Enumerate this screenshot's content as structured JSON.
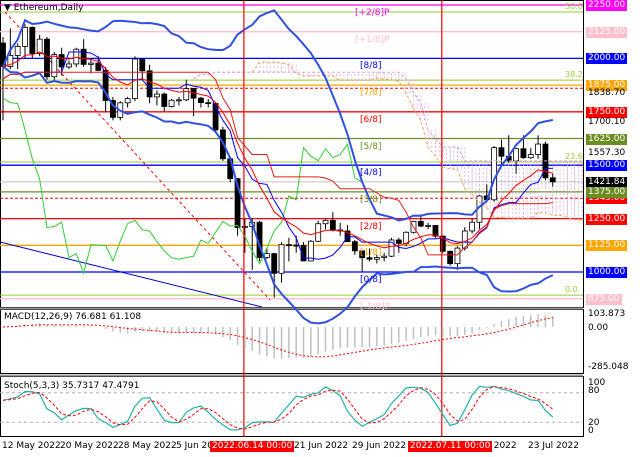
{
  "window": {
    "title": "Ethereum,Daily",
    "menu_icon": "triangle-down-icon"
  },
  "chart_data": [
    {
      "type": "candlestick",
      "title": "Ethereum,Daily",
      "ylim": [
        860.1,
        2250
      ],
      "x_ticks": [
        "12 May 2022",
        "20 May 2022",
        "28 May 2022",
        "5 Jun 2022",
        "21 Jun 2022",
        "29 Jun 2022",
        "Jul 2022",
        "23 Jul 2022"
      ],
      "markers": [
        {
          "label": "2022.06.14 00:00",
          "day_index": 33
        },
        {
          "label": "2022.07.11 00:00",
          "day_index": 60
        }
      ],
      "candles_ohlc": [
        [
          2072,
          2100,
          1710,
          1962
        ],
        [
          1962,
          2140,
          1950,
          2014
        ],
        [
          2014,
          2070,
          1950,
          2056
        ],
        [
          2056,
          2160,
          2000,
          2145
        ],
        [
          2145,
          2150,
          2000,
          2023
        ],
        [
          2023,
          2110,
          2010,
          2090
        ],
        [
          2090,
          2100,
          1900,
          1914
        ],
        [
          1914,
          2030,
          1900,
          2018
        ],
        [
          2018,
          2050,
          1920,
          1960
        ],
        [
          1960,
          1990,
          1950,
          1974
        ],
        [
          1974,
          2050,
          1960,
          2043
        ],
        [
          2043,
          2090,
          1960,
          1972
        ],
        [
          1972,
          2000,
          1930,
          1978
        ],
        [
          1978,
          2010,
          1940,
          1944
        ],
        [
          1944,
          1960,
          1750,
          1803
        ],
        [
          1803,
          1820,
          1710,
          1724
        ],
        [
          1724,
          1800,
          1710,
          1792
        ],
        [
          1792,
          1820,
          1770,
          1812
        ],
        [
          1812,
          2010,
          1800,
          1997
        ],
        [
          1997,
          2000,
          1900,
          1942
        ],
        [
          1942,
          1970,
          1790,
          1820
        ],
        [
          1820,
          1850,
          1780,
          1833
        ],
        [
          1833,
          1840,
          1750,
          1775
        ],
        [
          1775,
          1810,
          1770,
          1804
        ],
        [
          1804,
          1820,
          1780,
          1806
        ],
        [
          1806,
          1900,
          1800,
          1859
        ],
        [
          1859,
          1860,
          1730,
          1814
        ],
        [
          1814,
          1820,
          1770,
          1793
        ],
        [
          1793,
          1810,
          1770,
          1789
        ],
        [
          1789,
          1790,
          1650,
          1665
        ],
        [
          1665,
          1680,
          1520,
          1530
        ],
        [
          1530,
          1540,
          1420,
          1437
        ],
        [
          1437,
          1440,
          1170,
          1208
        ],
        [
          1208,
          1250,
          1090,
          1213
        ],
        [
          1213,
          1250,
          1010,
          1233
        ],
        [
          1233,
          1240,
          1050,
          1068
        ],
        [
          1068,
          1110,
          1060,
          1086
        ],
        [
          1086,
          1090,
          880,
          994
        ],
        [
          994,
          1140,
          950,
          1128
        ],
        [
          1128,
          1160,
          1050,
          1126
        ],
        [
          1126,
          1170,
          1090,
          1124
        ],
        [
          1124,
          1140,
          1050,
          1052
        ],
        [
          1052,
          1150,
          1050,
          1144
        ],
        [
          1144,
          1240,
          1140,
          1226
        ],
        [
          1226,
          1250,
          1200,
          1242
        ],
        [
          1242,
          1280,
          1190,
          1197
        ],
        [
          1197,
          1230,
          1170,
          1192
        ],
        [
          1192,
          1220,
          1140,
          1142
        ],
        [
          1142,
          1150,
          1080,
          1099
        ],
        [
          1099,
          1100,
          1000,
          1067
        ],
        [
          1067,
          1110,
          1050,
          1060
        ],
        [
          1060,
          1080,
          1040,
          1068
        ],
        [
          1068,
          1090,
          1050,
          1074
        ],
        [
          1074,
          1160,
          1070,
          1150
        ],
        [
          1150,
          1160,
          1090,
          1134
        ],
        [
          1134,
          1190,
          1120,
          1186
        ],
        [
          1186,
          1240,
          1180,
          1237
        ],
        [
          1237,
          1270,
          1210,
          1215
        ],
        [
          1215,
          1230,
          1200,
          1218
        ],
        [
          1218,
          1220,
          1160,
          1168
        ],
        [
          1168,
          1170,
          1090,
          1097
        ],
        [
          1097,
          1100,
          1030,
          1039
        ],
        [
          1039,
          1120,
          1010,
          1112
        ],
        [
          1112,
          1210,
          1100,
          1192
        ],
        [
          1192,
          1250,
          1180,
          1233
        ],
        [
          1233,
          1360,
          1200,
          1356
        ],
        [
          1356,
          1410,
          1330,
          1338
        ],
        [
          1338,
          1590,
          1330,
          1582
        ],
        [
          1582,
          1620,
          1500,
          1542
        ],
        [
          1542,
          1640,
          1510,
          1521
        ],
        [
          1521,
          1580,
          1460,
          1577
        ],
        [
          1577,
          1640,
          1530,
          1535
        ],
        [
          1535,
          1580,
          1530,
          1550
        ],
        [
          1550,
          1640,
          1530,
          1599
        ],
        [
          1599,
          1610,
          1430,
          1441
        ],
        [
          1441,
          1460,
          1400,
          1422
        ]
      ],
      "murray_levels": [
        {
          "label": "[+2/8]P",
          "price": 2250,
          "color": "#ff00ff"
        },
        {
          "label": "[+1/8]P",
          "price": 2125,
          "color": "#ffc0cb"
        },
        {
          "label": "[8/8]",
          "price": 2000,
          "color": "#0000ff"
        },
        {
          "label": "[7/8]",
          "price": 1875,
          "color": "#ffa500"
        },
        {
          "label": "[6/8]",
          "price": 1750,
          "color": "#ff0000"
        },
        {
          "label": "[5/8]",
          "price": 1625,
          "color": "#6b8e23"
        },
        {
          "label": "[4/8]",
          "price": 1500,
          "color": "#0000ff"
        },
        {
          "label": "[3/8]",
          "price": 1375,
          "color": "#6b8e23"
        },
        {
          "label": "[2/8]",
          "price": 1250,
          "color": "#ff0000"
        },
        {
          "label": "[1/8]",
          "price": 1125,
          "color": "#ffa500"
        },
        {
          "label": "[0/8]",
          "price": 1000,
          "color": "#0000ff"
        },
        {
          "label": "[-1/8]P",
          "price": 875,
          "color": "#ffc0cb"
        }
      ],
      "fibo_levels": [
        {
          "label": "50.0",
          "price": 2217
        },
        {
          "label": "38.2",
          "price": 1898
        },
        {
          "label": "23.6",
          "price": 1515
        },
        {
          "label": "0.0",
          "price": 892
        }
      ],
      "price_axis": [
        {
          "text": "2250.00",
          "price": 2250,
          "bg": "#ff00ff"
        },
        {
          "text": "2125.00",
          "price": 2125,
          "bg": "#ffc0cb"
        },
        {
          "text": "2000.00",
          "price": 2000,
          "bg": "#0000ff"
        },
        {
          "text": "1875.00",
          "price": 1875,
          "bg": "#ffa500"
        },
        {
          "text": "1838.70",
          "price": 1838.7,
          "bg": ""
        },
        {
          "text": "1750.00",
          "price": 1750,
          "bg": "#ff0000"
        },
        {
          "text": "1700.10",
          "price": 1700.1,
          "bg": ""
        },
        {
          "text": "1625.00",
          "price": 1625,
          "bg": "#6b8e23"
        },
        {
          "text": "1557.30",
          "price": 1557.3,
          "bg": ""
        },
        {
          "text": "1500.00",
          "price": 1500,
          "bg": "#0000ff"
        },
        {
          "text": "1345.00",
          "price": 1345,
          "bg": "#ff0000"
        },
        {
          "text": "1421.84",
          "price": 1421.84,
          "bg": "#000000"
        },
        {
          "text": "1375.00",
          "price": 1375,
          "bg": "#6b8e23"
        },
        {
          "text": "1250.00",
          "price": 1250,
          "bg": "#ff0000"
        },
        {
          "text": "1125.00",
          "price": 1125,
          "bg": "#ffa500"
        },
        {
          "text": "1000.00",
          "price": 1000,
          "bg": "#0000ff"
        },
        {
          "text": "875.00",
          "price": 875,
          "bg": "#ffc0cb"
        }
      ],
      "dashed_levels": [
        1345,
        1860
      ],
      "current_price": 1421.84
    },
    {
      "type": "macd",
      "label": "MACD(12,26,9) 76.681 61.108",
      "params": [
        12,
        26,
        9
      ],
      "ylim": [
        -285.048,
        103.873
      ],
      "axis": [
        "103.873",
        "0.00",
        "-285.048"
      ]
    },
    {
      "type": "stochastic",
      "label": "Stoch(5,3,3) 35.7317 47.4791",
      "params": [
        5,
        3,
        3
      ],
      "ylim": [
        0,
        100
      ],
      "levels": [
        20,
        80
      ],
      "axis": [
        "100",
        "80",
        "20",
        "0"
      ]
    }
  ]
}
